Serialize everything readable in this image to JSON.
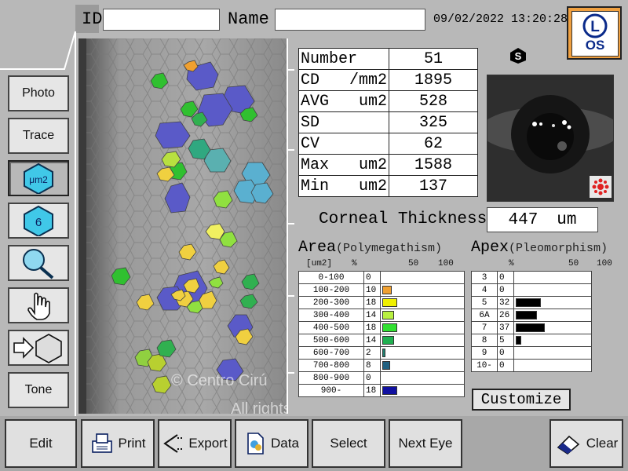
{
  "header": {
    "id_label": "ID",
    "id_value": "",
    "name_label": "Name",
    "name_value": "",
    "datetime": "09/02/2022 13:20:28",
    "eye_letter": "L",
    "eye_label": "OS"
  },
  "sidebar": {
    "items": [
      {
        "label": "Photo",
        "icon": ""
      },
      {
        "label": "Trace",
        "icon": ""
      },
      {
        "label": "μm2",
        "icon": "hexagon-icon"
      },
      {
        "label": "6",
        "icon": "hexagon-icon"
      },
      {
        "label": "",
        "icon": "magnifier-icon"
      },
      {
        "label": "",
        "icon": "hand-icon"
      },
      {
        "label": "",
        "icon": "arrow-hexagon-icon"
      },
      {
        "label": "Tone",
        "icon": ""
      }
    ]
  },
  "stats": {
    "rows": [
      {
        "label": "Number",
        "unit": "",
        "value": "51"
      },
      {
        "label": "CD",
        "unit": "/mm2",
        "value": "1895"
      },
      {
        "label": "AVG",
        "unit": "um2",
        "value": "528"
      },
      {
        "label": "SD",
        "unit": "",
        "value": "325"
      },
      {
        "label": "CV",
        "unit": "",
        "value": "62"
      },
      {
        "label": "Max",
        "unit": "um2",
        "value": "1588"
      },
      {
        "label": "Min",
        "unit": "um2",
        "value": "137"
      }
    ]
  },
  "s_badge": "S",
  "corneal": {
    "label": "Corneal Thickness",
    "value": "447",
    "unit": "um"
  },
  "area": {
    "title": "Area",
    "subtitle": "(Polymegathism)",
    "unit_label": "[um2]",
    "pct_label": "%",
    "tick50": "50",
    "tick100": "100",
    "rows": [
      {
        "range": "0-100",
        "pct": 0,
        "color": "#ffffff"
      },
      {
        "range": "100-200",
        "pct": 10,
        "color": "#f0a030"
      },
      {
        "range": "200-300",
        "pct": 18,
        "color": "#f0f000"
      },
      {
        "range": "300-400",
        "pct": 14,
        "color": "#b8f040"
      },
      {
        "range": "400-500",
        "pct": 18,
        "color": "#30e030"
      },
      {
        "range": "500-600",
        "pct": 14,
        "color": "#20b050"
      },
      {
        "range": "600-700",
        "pct": 2,
        "color": "#208070"
      },
      {
        "range": "700-800",
        "pct": 8,
        "color": "#206080"
      },
      {
        "range": "800-900",
        "pct": 0,
        "color": "#204090"
      },
      {
        "range": "900-",
        "pct": 18,
        "color": "#1010a0"
      }
    ]
  },
  "apex": {
    "title": "Apex",
    "subtitle": "(Pleomorphism)",
    "pct_label": "%",
    "tick50": "50",
    "tick100": "100",
    "rows": [
      {
        "label": "3",
        "pct": 0
      },
      {
        "label": "4",
        "pct": 0
      },
      {
        "label": "5",
        "pct": 32
      },
      {
        "label": "6A",
        "pct": 26
      },
      {
        "label": "7",
        "pct": 37
      },
      {
        "label": "8",
        "pct": 5
      },
      {
        "label": "9",
        "pct": 0
      },
      {
        "label": "10-",
        "pct": 0
      }
    ]
  },
  "customize_label": "Customize",
  "watermark": {
    "line1": "© Centro Cirú",
    "line2": "All rights reserved"
  },
  "bottom": {
    "edit": "Edit",
    "print": "Print",
    "export": "Export",
    "data": "Data",
    "select": "Select",
    "next_eye": "Next Eye",
    "clear": "Clear"
  }
}
